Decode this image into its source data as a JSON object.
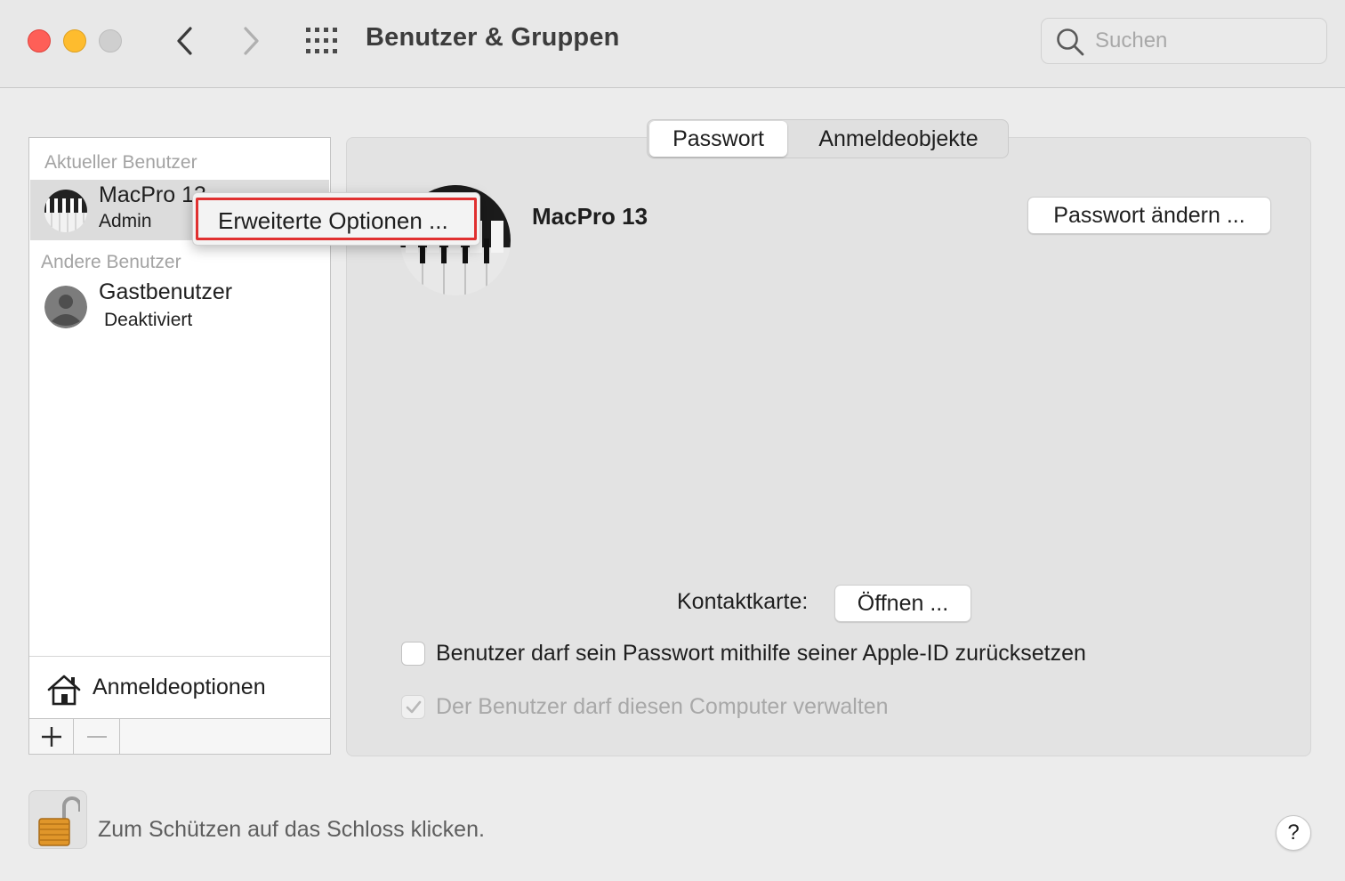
{
  "window": {
    "title": "Benutzer & Gruppen",
    "search_placeholder": "Suchen",
    "traffic_lights": [
      "close",
      "minimize",
      "zoom"
    ],
    "nav_icons": [
      "chevron-left-icon",
      "chevron-right-icon",
      "grid-icon"
    ]
  },
  "sidebar": {
    "current_header": "Aktueller Benutzer",
    "other_header": "Andere Benutzer",
    "current_user": {
      "name": "MacPro 13",
      "role": "Admin"
    },
    "other_users": [
      {
        "name": "Gastbenutzer",
        "status": "Deaktiviert"
      }
    ],
    "login_options_label": "Anmeldeoptionen",
    "add_label": "+",
    "remove_label": "—"
  },
  "context_menu": {
    "item": "Erweiterte Optionen ..."
  },
  "tabs": [
    {
      "label": "Passwort",
      "active": true
    },
    {
      "label": "Anmeldeobjekte",
      "active": false
    }
  ],
  "detail": {
    "user_name": "MacPro 13",
    "change_password_label": "Passwort ändern ...",
    "contact_label": "Kontaktkarte:",
    "open_label": "Öffnen ...",
    "checkbox_reset": {
      "label": "Benutzer darf sein Passwort mithilfe seiner Apple-ID zurücksetzen",
      "checked": false
    },
    "checkbox_admin": {
      "label": "Der Benutzer darf diesen Computer verwalten",
      "checked": true,
      "disabled": true
    }
  },
  "footer": {
    "lock_text": "Zum Schützen auf das Schloss klicken.",
    "help_label": "?"
  },
  "colors": {
    "close": "#fe5f57",
    "minimize": "#febc2e",
    "zoom": "#cfcfcf",
    "highlight_border": "#e03030",
    "lock_gold": "#e0962a"
  }
}
